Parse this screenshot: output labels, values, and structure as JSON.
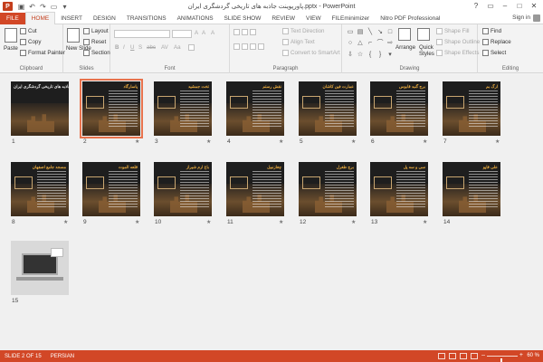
{
  "app": {
    "icon_letter": "P",
    "title": "پاورپوینت جاذبه های تاریخی گردشگری ایران.pptx - PowerPoint",
    "sign_in": "Sign in",
    "accent": "#d24726"
  },
  "qat": [
    "save-icon",
    "undo-icon",
    "redo-icon",
    "start-slideshow-icon",
    "customize-icon"
  ],
  "window_controls": [
    "?",
    "▭",
    "–",
    "□",
    "✕"
  ],
  "tabs": [
    "FILE",
    "HOME",
    "INSERT",
    "DESIGN",
    "TRANSITIONS",
    "ANIMATIONS",
    "SLIDE SHOW",
    "REVIEW",
    "VIEW",
    "FILEminimizer",
    "Nitro PDF Professional"
  ],
  "active_tab": "HOME",
  "ribbon": {
    "clipboard": {
      "label": "Clipboard",
      "paste": "Paste",
      "cut": "Cut",
      "copy": "Copy",
      "format_painter": "Format Painter"
    },
    "slides": {
      "label": "Slides",
      "new_slide": "New Slide",
      "layout": "Layout",
      "reset": "Reset",
      "section": "Section"
    },
    "font": {
      "label": "Font",
      "bold": "B",
      "italic": "I",
      "underline": "U",
      "shadow": "S",
      "strikethrough": "abc",
      "spacing": "AV",
      "case": "Aa",
      "grow": "A",
      "shrink": "A",
      "clear": "A"
    },
    "paragraph": {
      "label": "Paragraph",
      "text_direction": "Text Direction",
      "align_text": "Align Text",
      "convert_smartart": "Convert to SmartArt"
    },
    "drawing": {
      "label": "Drawing",
      "arrange": "Arrange",
      "quick_styles": "Quick Styles",
      "shape_fill": "Shape Fill",
      "shape_outline": "Shape Outline",
      "shape_effects": "Shape Effects"
    },
    "editing": {
      "label": "Editing",
      "find": "Find",
      "replace": "Replace",
      "select": "Select"
    }
  },
  "slides": [
    {
      "n": "1",
      "title": "جاذبه های تاریخی گردشگری ایران",
      "star": ""
    },
    {
      "n": "2",
      "title": "پاسارگاد",
      "star": "★"
    },
    {
      "n": "3",
      "title": "تخت جمشید",
      "star": "★"
    },
    {
      "n": "4",
      "title": "نقش رستم",
      "star": "★"
    },
    {
      "n": "5",
      "title": "عمارت فین کاشان",
      "star": "★"
    },
    {
      "n": "6",
      "title": "برج گنبد قابوس",
      "star": "★"
    },
    {
      "n": "7",
      "title": "ارگ بم",
      "star": "★"
    },
    {
      "n": "8",
      "title": "مسجد جامع اصفهان",
      "star": "★"
    },
    {
      "n": "9",
      "title": "قلعه الموت",
      "star": "★"
    },
    {
      "n": "10",
      "title": "باغ ارم شیراز",
      "star": "★"
    },
    {
      "n": "11",
      "title": "چغازنبیل",
      "star": "★"
    },
    {
      "n": "12",
      "title": "برج طغرل",
      "star": "★"
    },
    {
      "n": "13",
      "title": "سی و سه پل",
      "star": "★"
    },
    {
      "n": "14",
      "title": "علی قاپو",
      "star": ""
    },
    {
      "n": "15",
      "title": "",
      "star": ""
    }
  ],
  "selected_slide": "2",
  "status": {
    "slide": "SLIDE 2 OF 15",
    "language": "PERSIAN",
    "zoom": "60 %",
    "zoom_level": 0.6
  }
}
